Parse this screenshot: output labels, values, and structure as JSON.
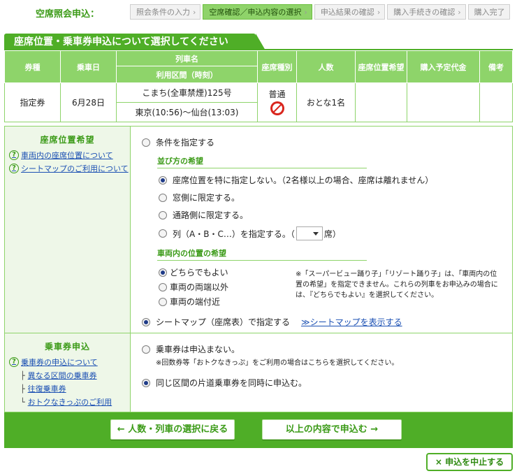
{
  "steps": {
    "label": "空席照会申込：",
    "items": [
      {
        "label": "照会条件の入力",
        "state": "done"
      },
      {
        "label": "空席確認／申込内容の選択",
        "state": "active"
      },
      {
        "label": "申込結果の確認",
        "state": "todo"
      },
      {
        "label": "購入手続きの確認",
        "state": "todo"
      },
      {
        "label": "購入完了",
        "state": "todo"
      }
    ]
  },
  "title": "座席位置・乗車券申込について選択してください",
  "table": {
    "headers": {
      "ticket_type": "券種",
      "date": "乗車日",
      "train_name": "列車名",
      "section": "利用区間（時刻）",
      "seat_type": "座席種別",
      "people": "人数",
      "seat_pref": "座席位置希望",
      "price": "購入予定代金",
      "remarks": "備考"
    },
    "row": {
      "ticket_type": "指定券",
      "date": "6月28日",
      "train_name": "こまち(全車禁煙)125号",
      "section": "東京(10:56)～仙台(13:03)",
      "seat_type": "普通",
      "people": "おとな1名",
      "seat_pref": "",
      "price": "",
      "remarks": ""
    }
  },
  "seat_section": {
    "heading": "座席位置希望",
    "help_links": [
      "車両内の座席位置について",
      "シートマップのご利用について"
    ],
    "opt_specify": "条件を指定する",
    "arrangement_heading": "並び方の希望",
    "arrangement_options": [
      {
        "label": "座席位置を特に指定しない。（2名様以上の場合、座席は離れません）",
        "selected": true
      },
      {
        "label": "窓側に限定する。",
        "selected": false
      },
      {
        "label": "通路側に限定する。",
        "selected": false
      }
    ],
    "column_prefix": "列（A・B・C…）を指定する。（",
    "column_suffix": "席）",
    "position_heading": "車両内の位置の希望",
    "position_options": [
      {
        "label": "どちらでもよい",
        "selected": true
      },
      {
        "label": "車両の両端以外",
        "selected": false
      },
      {
        "label": "車両の端付近",
        "selected": false
      }
    ],
    "position_note": "※「スーパービュー踊り子」「リゾート踊り子」は、「車両内の位置の希望」を指定できません。これらの列車をお申込みの場合には、『どちらでもよい』を選択してください。",
    "opt_seatmap": "シートマップ（座席表）で指定する",
    "seatmap_link": "≫シートマップを表示する"
  },
  "ticket_section": {
    "heading": "乗車券申込",
    "help_link": "乗車券の申込について",
    "sub_links": [
      "異なる区間の乗車券",
      "往復乗車券",
      "おトクなきっぷのご利用"
    ],
    "opt_none": "乗車券は申込まない。",
    "opt_none_note": "※回数券等「おトクなきっぷ」をご利用の場合はこちらを選択してください。",
    "opt_same": "同じ区間の片道乗車券を同時に申込む。"
  },
  "buttons": {
    "back": "← 人数・列車の選択に戻る",
    "submit": "以上の内容で申込む →",
    "cancel": "× 申込を中止する"
  },
  "colors": {
    "accent": "#4fae27",
    "header": "#8ed46a",
    "link": "#1a4fb3"
  }
}
